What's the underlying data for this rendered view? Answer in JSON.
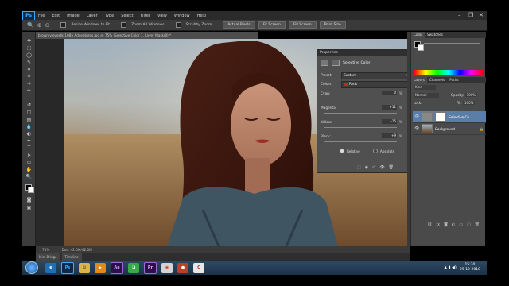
{
  "menubar": {
    "logo": "Ps",
    "items": [
      "File",
      "Edit",
      "Image",
      "Layer",
      "Type",
      "Select",
      "Filter",
      "View",
      "Window",
      "Help"
    ]
  },
  "options": {
    "resize_label": "Resize Windows to Fit",
    "zoom_all_label": "Zoom All Windows",
    "scrubby_label": "Scrubby Zoom",
    "buttons": [
      "Actual Pixels",
      "Fit Screen",
      "Fill Screen",
      "Print Size"
    ]
  },
  "document": {
    "tab_title": "brown-vieyestk-1085 Adventures.jpg @ 75% (Selective Color 1, Layer Mask/8) *"
  },
  "status": {
    "zoom": "75%",
    "doc_info": "Doc: 42.0M/42.0M"
  },
  "bottom_tabs": [
    "Mini Bridge",
    "Timeline"
  ],
  "properties": {
    "header": "Properties",
    "title": "Selective Color",
    "preset_label": "Preset:",
    "preset_value": "Custom",
    "colors_label": "Colors:",
    "colors_value": "Reds",
    "sliders": [
      {
        "label": "Cyan:",
        "value": "0",
        "unit": "%"
      },
      {
        "label": "Magenta:",
        "value": "+11",
        "unit": "%"
      },
      {
        "label": "Yellow:",
        "value": "-15",
        "unit": "%"
      },
      {
        "label": "Black:",
        "value": "+9",
        "unit": "%"
      }
    ],
    "relative_label": "Relative",
    "absolute_label": "Absolute"
  },
  "right_panel": {
    "tabs_top": [
      "Color",
      "Swatches"
    ],
    "tabs_mid": [
      "Layers",
      "Channels",
      "Paths"
    ],
    "kind_label": "Kind",
    "blend_mode": "Normal",
    "opacity_label": "Opacity:",
    "opacity_value": "100%",
    "fill_label": "Fill:",
    "fill_value": "100%",
    "lock_label": "Lock:",
    "layers": [
      {
        "name": "Selective Co...",
        "selected": true
      },
      {
        "name": "Background",
        "selected": false
      }
    ]
  },
  "taskbar": {
    "apps": [
      {
        "name": "ie",
        "glyph": "e",
        "color": "#1f6fb5"
      },
      {
        "name": "photoshop",
        "glyph": "Ps",
        "color": "#0b2a4a"
      },
      {
        "name": "explorer",
        "glyph": "▤",
        "color": "#d9b64a"
      },
      {
        "name": "media",
        "glyph": "▶",
        "color": "#e08a1a"
      },
      {
        "name": "after-effects",
        "glyph": "Ae",
        "color": "#2a1248"
      },
      {
        "name": "camtasia",
        "glyph": "◪",
        "color": "#3aa84a"
      },
      {
        "name": "premiere",
        "glyph": "Pr",
        "color": "#2a1248"
      },
      {
        "name": "chrome",
        "glyph": "◉",
        "color": "#d4d4d4"
      },
      {
        "name": "recorder",
        "glyph": "●",
        "color": "#b8412a"
      },
      {
        "name": "ccleaner",
        "glyph": "C",
        "color": "#e6e6e6"
      }
    ],
    "time": "15:30",
    "date": "29-12-2018"
  },
  "colors": {
    "accent_swatch": "#c0291e",
    "fg_swatch": "#000000",
    "bg_swatch": "#ffffff"
  }
}
